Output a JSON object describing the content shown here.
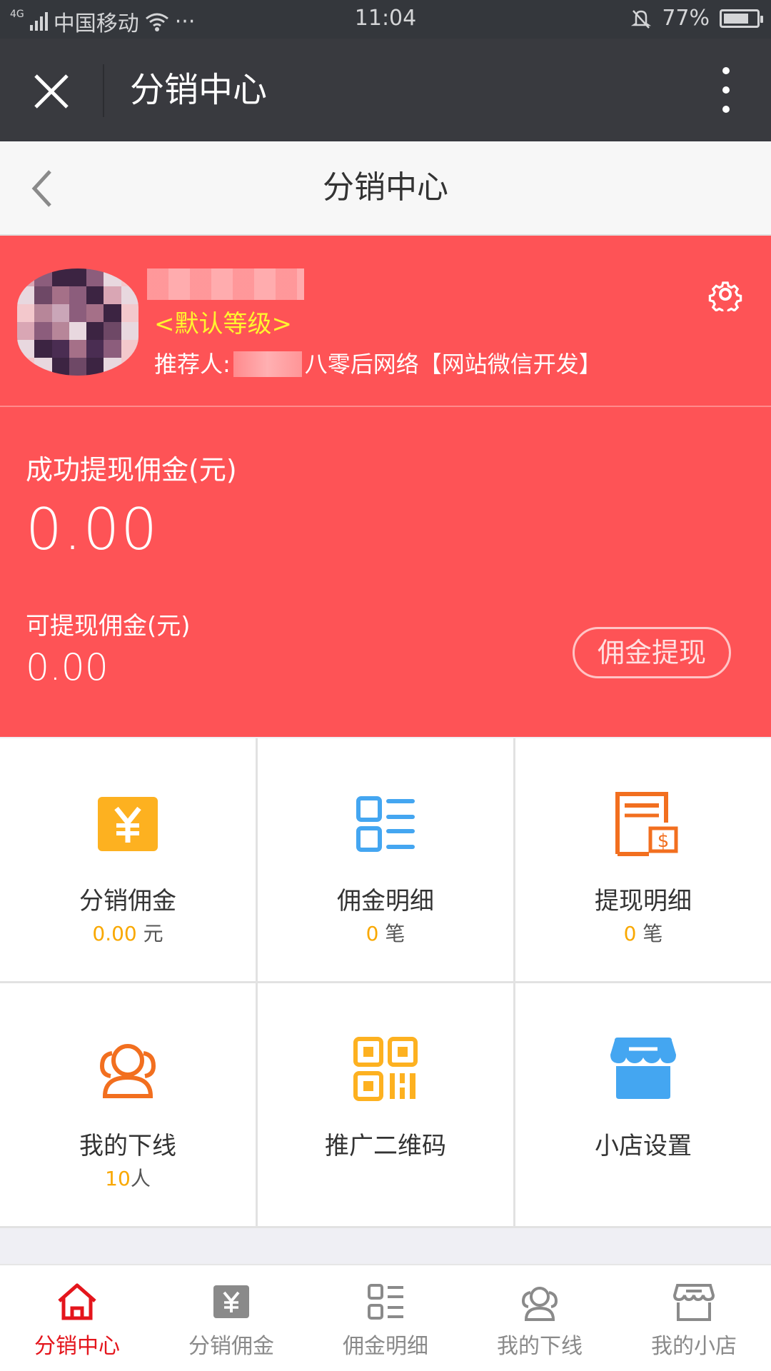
{
  "status_bar": {
    "network": "4G",
    "carrier": "中国移动",
    "more": "···",
    "time": "11:04",
    "battery": "77%",
    "battery_level": 0.77
  },
  "wechat_bar": {
    "title": "分销中心"
  },
  "page_header": {
    "title": "分销中心"
  },
  "profile": {
    "level": "<默认等级>",
    "referrer_prefix": "推荐人:",
    "referrer_name": "八零后网络【网站微信开发】"
  },
  "earnings": {
    "withdrawn_label": "成功提现佣金(元)",
    "withdrawn_value": "0.00",
    "available_label": "可提现佣金(元)",
    "available_value": "0.00",
    "withdraw_button": "佣金提现"
  },
  "menu": [
    {
      "label": "分销佣金",
      "num": "0.00",
      "unit": " 元",
      "icon": "yuan-icon"
    },
    {
      "label": "佣金明细",
      "num": "0",
      "unit": " 笔",
      "icon": "list-detail-icon"
    },
    {
      "label": "提现明细",
      "num": "0",
      "unit": " 笔",
      "icon": "withdraw-record-icon"
    },
    {
      "label": "我的下线",
      "num": "10",
      "unit": "人",
      "icon": "users-icon"
    },
    {
      "label": "推广二维码",
      "icon": "qrcode-icon"
    },
    {
      "label": "小店设置",
      "icon": "shop-icon"
    }
  ],
  "tabbar": [
    {
      "label": "分销中心",
      "icon": "home-icon",
      "active": true
    },
    {
      "label": "分销佣金",
      "icon": "yuan-icon"
    },
    {
      "label": "佣金明细",
      "icon": "list-detail-icon"
    },
    {
      "label": "我的下线",
      "icon": "users-icon"
    },
    {
      "label": "我的小店",
      "icon": "shop-icon"
    }
  ],
  "colors": {
    "accent_red": "#fe5356",
    "level_yellow": "#fff52f",
    "number_orange": "#f9a800",
    "tab_active": "#e4151c",
    "icon_orange": "#fdb120",
    "icon_blue": "#44a6f1",
    "icon_deep_orange": "#f26f1f",
    "tab_gray": "#8a8a8a"
  }
}
